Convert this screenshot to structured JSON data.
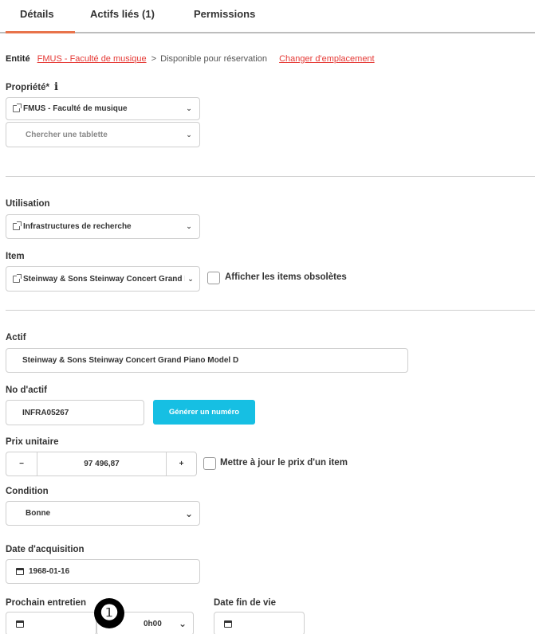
{
  "tabs": [
    {
      "label": "Détails",
      "active": true
    },
    {
      "label": "Actifs liés (1)",
      "active": false
    },
    {
      "label": "Permissions",
      "active": false
    }
  ],
  "breadcrumb": {
    "prefix": "Entité",
    "link": "FMUS - Faculté de musique",
    "separator": ">",
    "status": "Disponible pour réservation",
    "action": "Changer d'emplacement"
  },
  "property": {
    "label": "Propriété*",
    "value": "FMUS - Faculté de musique",
    "shelf_placeholder": "Chercher une tablette"
  },
  "usage": {
    "label": "Utilisation",
    "value": "Infrastructures de recherche"
  },
  "item": {
    "label": "Item",
    "value": "Steinway & Sons Steinway Concert Grand Piano Model D",
    "show_obsolete_label": "Afficher les items obsolètes"
  },
  "asset": {
    "label": "Actif",
    "value": "Steinway & Sons Steinway Concert Grand Piano Model D"
  },
  "asset_number": {
    "label": "No d'actif",
    "value": "INFRA05267",
    "generate_label": "Générer un numéro"
  },
  "unit_price": {
    "label": "Prix unitaire",
    "minus": "−",
    "value": "97 496,87",
    "plus": "+",
    "update_label": "Mettre à jour le prix d'un item"
  },
  "condition": {
    "label": "Condition",
    "value": "Bonne"
  },
  "acquisition": {
    "label": "Date d'acquisition",
    "value": "1968-01-16"
  },
  "next_maintenance": {
    "label": "Prochain entretien",
    "time_value": "0h00"
  },
  "end_of_life": {
    "label": "Date fin de vie"
  },
  "annotation_marker": "❶",
  "colors": {
    "accent": "#e8734a",
    "link": "#e53935",
    "button": "#16bfe3"
  }
}
